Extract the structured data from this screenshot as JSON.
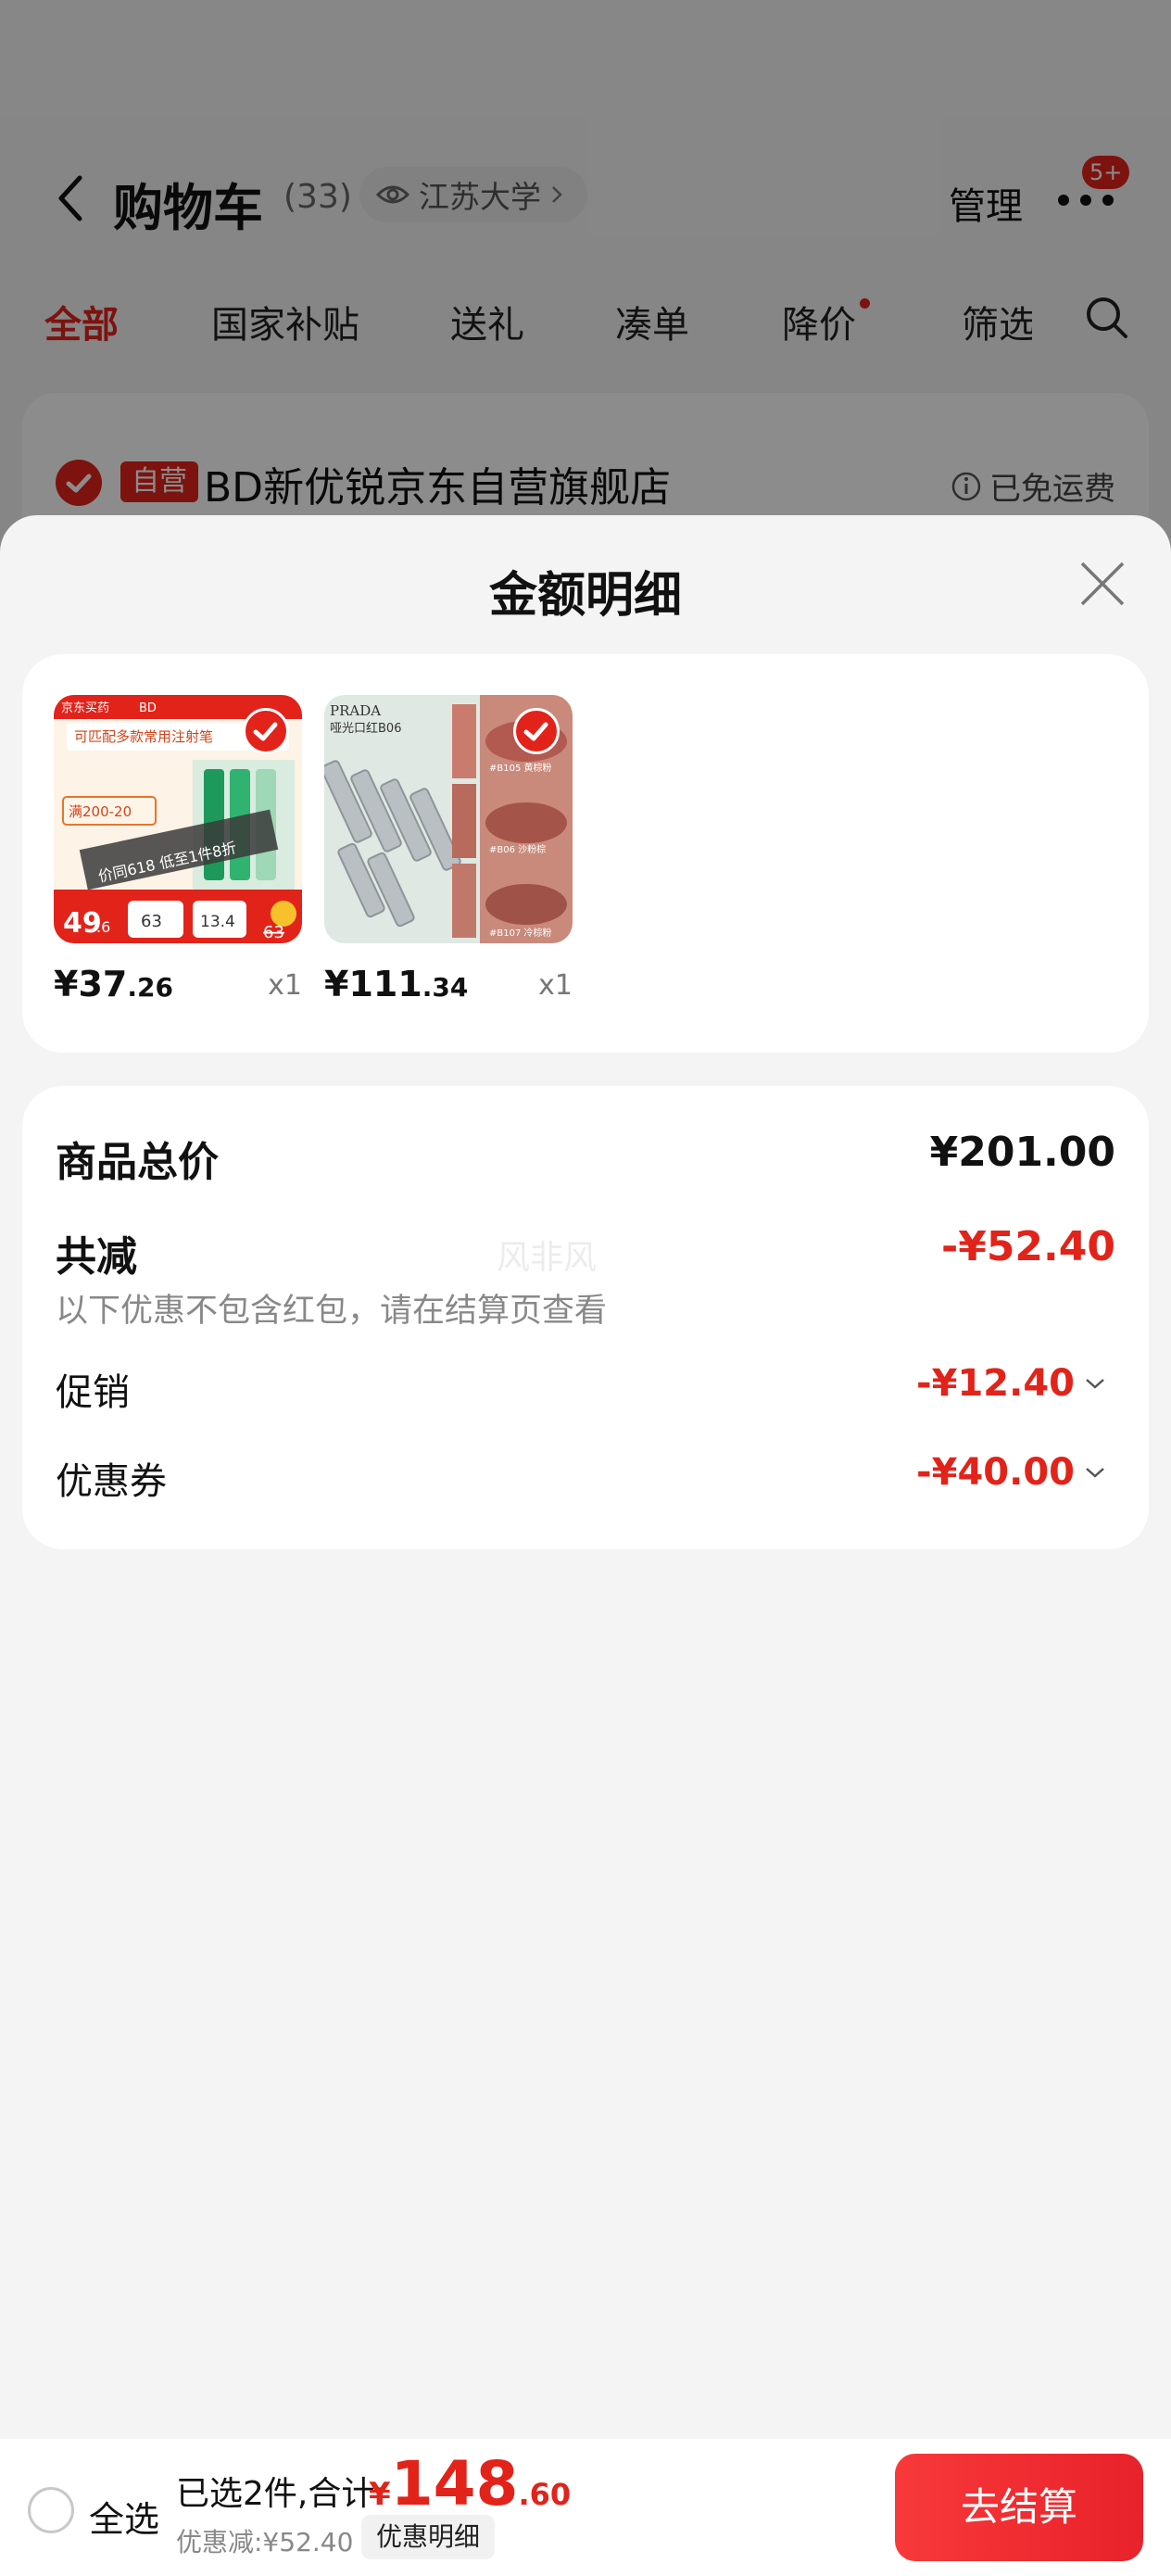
{
  "header": {
    "title": "购物车",
    "count": "(33)",
    "location": "江苏大学",
    "manage": "管理",
    "badge": "5+"
  },
  "tabs": [
    "全部",
    "国家补贴",
    "送礼",
    "凑单",
    "降价",
    "筛选"
  ],
  "store": {
    "tag": "自营",
    "name": "BD新优锐京东自营旗舰店",
    "shipping": "已免运费"
  },
  "sheet": {
    "title": "金额明细"
  },
  "products": [
    {
      "price_int": "¥37",
      "price_dec": ".26",
      "qty": "x1",
      "image": "syringe-product-image",
      "image_text": {
        "brand": "京东买药",
        "b2": "BD",
        "headline": "可匹配多款常用注射笔",
        "coupon": "满200-20",
        "promo": "价同618 低至1件8折",
        "price": "49",
        "price_dec": ".6",
        "p1": "63",
        "p2": "13.4",
        "strike": "63"
      }
    },
    {
      "price_int": "¥111",
      "price_dec": ".34",
      "qty": "x1",
      "image": "lipstick-product-image",
      "image_text": {
        "brand": "PRADA",
        "subtitle": "哑光口红B06",
        "l1": "#B105 黄棕粉",
        "l2": "#B06 沙粉棕",
        "l3": "#B107 冷棕粉"
      }
    }
  ],
  "summary": {
    "total_label": "商品总价",
    "total_value": "¥201.00",
    "reduce_label": "共减",
    "reduce_value": "-¥52.40",
    "note": "以下优惠不包含红包，请在结算页查看",
    "promo_label": "促销",
    "promo_value": "-¥12.40",
    "coupon_label": "优惠券",
    "coupon_value": "-¥40.00",
    "watermark": "风非风"
  },
  "bottom": {
    "select_all": "全选",
    "selected_text": "已选2件,合计:",
    "currency": "¥",
    "total_int": "148",
    "total_dec": ".60",
    "saved": "优惠减:¥52.40",
    "detail_button": "优惠明细",
    "checkout": "去结算"
  },
  "colors": {
    "accent": "#e2231a",
    "background": "#f4f4f4"
  }
}
